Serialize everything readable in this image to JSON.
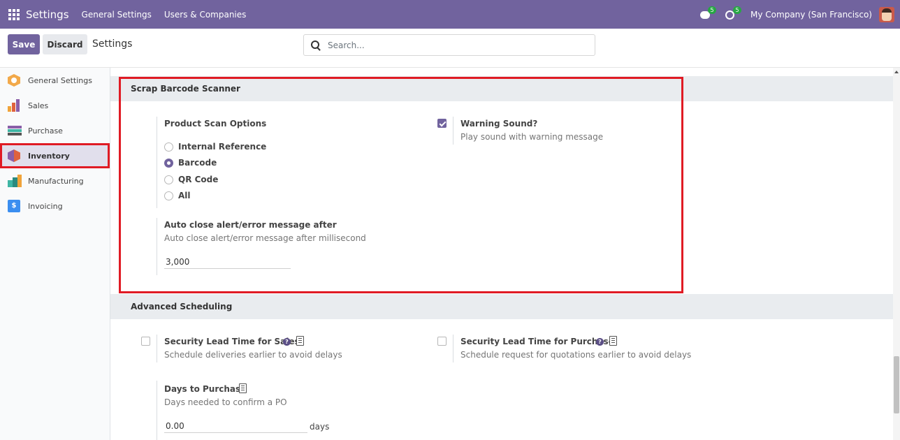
{
  "topbar": {
    "app_title": "Settings",
    "menu": [
      "General Settings",
      "Users & Companies"
    ],
    "chat_badge": "5",
    "activity_badge": "5",
    "company": "My Company (San Francisco)"
  },
  "control": {
    "save_label": "Save",
    "discard_label": "Discard",
    "title": "Settings",
    "search_placeholder": "Search..."
  },
  "sidebar": {
    "items": [
      {
        "label": "General Settings",
        "icon": "general-settings-icon"
      },
      {
        "label": "Sales",
        "icon": "sales-icon"
      },
      {
        "label": "Purchase",
        "icon": "purchase-icon"
      },
      {
        "label": "Inventory",
        "icon": "inventory-icon",
        "active": true
      },
      {
        "label": "Manufacturing",
        "icon": "manufacturing-icon"
      },
      {
        "label": "Invoicing",
        "icon": "invoicing-icon"
      }
    ]
  },
  "scrap": {
    "heading": "Scrap Barcode Scanner",
    "scan_options_label": "Product Scan Options",
    "options": [
      "Internal Reference",
      "Barcode",
      "QR Code",
      "All"
    ],
    "selected": "Barcode",
    "warning_label": "Warning Sound?",
    "warning_help": "Play sound with warning message",
    "warning_checked": true,
    "autoclose_label": "Auto close alert/error message after",
    "autoclose_help": "Auto close alert/error message after millisecond",
    "autoclose_value": "3,000"
  },
  "advanced": {
    "heading": "Advanced Scheduling",
    "sales_lead_label": "Security Lead Time for Sales",
    "sales_lead_help": "Schedule deliveries earlier to avoid delays",
    "purchase_lead_label": "Security Lead Time for Purchase",
    "purchase_lead_help": "Schedule request for quotations earlier to avoid delays",
    "days_label": "Days to Purchase",
    "days_help": "Days needed to confirm a PO",
    "days_value": "0.00",
    "days_unit": "days"
  },
  "colors": {
    "brand": "#71639e",
    "highlight": "#e01b24"
  }
}
